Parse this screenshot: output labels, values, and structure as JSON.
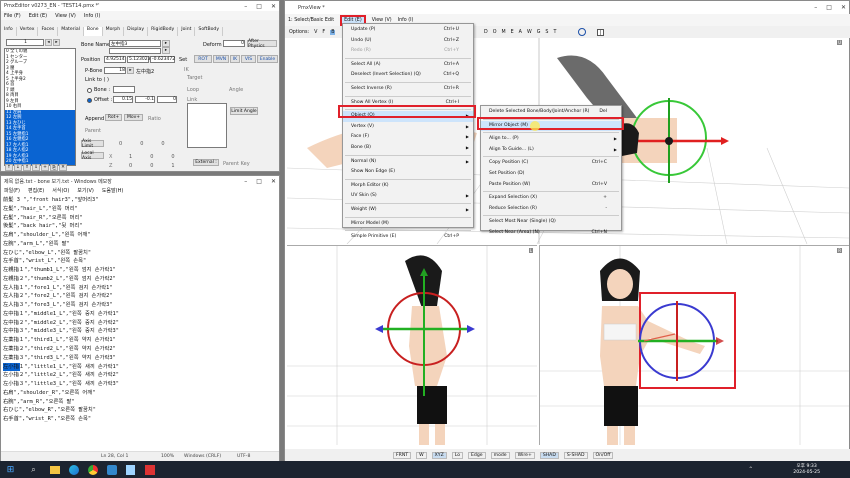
{
  "pmx": {
    "title": "PmxEditor v0273_EN - 'TEST14.pmx *'",
    "menu": [
      "File (F)",
      "Edit (E)",
      "View (V)",
      "Info (I)"
    ],
    "tabs": [
      "Info",
      "Vertex",
      "Faces",
      "Material",
      "Bone",
      "Morph",
      "Display",
      "RigidBody",
      "Joint",
      "SoftBody"
    ],
    "index": "1",
    "bones": [
      "0 全ての親",
      "1 センター",
      "2 グルーブ",
      "3 腰",
      "4 上半身",
      "5 上半身2",
      "6 首",
      "7 頭",
      "8 両目",
      "9 左目",
      "10 右目",
      "11 左肩",
      "12 左腕",
      "13 左ひじ",
      "14 左手首",
      "15 左親指1",
      "16 左親指2",
      "17 左人指1",
      "18 左人指2",
      "19 左人指3",
      "20 左中指1",
      "21 左中指2",
      "22 左中指3",
      "23 左薬指1",
      "24 左薬指2",
      "25 左薬指3",
      "26 左小指1",
      "27 左小指2",
      "28 左小指3",
      "29 右肩"
    ],
    "bone_name_label": "Bone Name",
    "bone_name": "左中指3",
    "bone_name_en": "",
    "defaults_label": "Deform",
    "deform_value": "0",
    "after_physics": "After Physics",
    "position_label": "Position",
    "pos": [
      "4.92514",
      "5.123023",
      "-0.623472"
    ],
    "set": "Set",
    "rot": "ROT",
    "mvn": "MVN",
    "ik": "IK",
    "vis": "VIS",
    "enable": "Enable",
    "pbone_label": "P-Bone",
    "pbone_value": "18",
    "pbone_name": "左中指2",
    "link_to": "Link to ( )",
    "bone_radio": "Bone :",
    "offset_radio": "Offset :",
    "offset": [
      "0.15",
      "-0.1",
      "0"
    ],
    "ik_label": "IK",
    "target_label": "Target",
    "loop_label": "Loop",
    "angle_label": "Angle",
    "link_label": "Link",
    "append_label": "Append",
    "rot_plus": "Rot+",
    "mov_plus": "Mov+",
    "ratio_label": "Ratio",
    "parent_label": "Parent",
    "fix_axis": "Axis Limit",
    "local_axis": "Local Axis",
    "x": "X",
    "z": "Z",
    "external": "External :",
    "parent_key": "Parent Key",
    "limit_angle": "Limit Angle",
    "axis_vals": [
      "0",
      "0",
      "0"
    ],
    "local_x": [
      "1",
      "0",
      "0"
    ],
    "local_z": [
      "0",
      "0",
      "1"
    ]
  },
  "notepad": {
    "title": "제목 없음.txt - bone 보기.txt - Windows 메모장",
    "menu": [
      "파일(F)",
      "편집(E)",
      "서식(O)",
      "보기(V)",
      "도움말(H)"
    ],
    "lines": [
      "前髪 3 \",\"front hair3\",\"앞머리3\"",
      "左髪\",\"hair_L\",\"왼쪽 머리\"",
      "右髪\",\"hair_R\",\"오른쪽 머리\"",
      "後髪\",\"back hair\",\"뒷 머리\"",
      "左肩\",\"shoulder_L\",\"왼쪽 어깨\"",
      "左腕\",\"arm_L\",\"왼쪽 팔\"",
      "左ひじ\",\"elbow_L\",\"왼쪽 팔꿈치\"",
      "左手首\",\"wrist_L\",\"왼쪽 손목\"",
      "左親指１\",\"thumb1_L\",\"왼쪽 엄지 손가락1\"",
      "左親指２\",\"thumb2_L\",\"왼쪽 엄지 손가락2\"",
      "左人指１\",\"fore1_L\",\"왼쪽 검지 손가락1\"",
      "左人指２\",\"fore2_L\",\"왼쪽 검지 손가락2\"",
      "左人指３\",\"fore3_L\",\"왼쪽 검지 손가락3\"",
      "左中指１\",\"middle1_L\",\"왼쪽 중지 손가락1\"",
      "左中指２\",\"middle2_L\",\"왼쪽 중지 손가락2\"",
      "左中指３\",\"middle3_L\",\"왼쪽 중지 손가락3\"",
      "左薬指１\",\"third1_L\",\"왼쪽 약지 손가락1\"",
      "左薬指２\",\"third2_L\",\"왼쪽 약지 손가락2\"",
      "左薬指３\",\"third3_L\",\"왼쪽 약지 손가락3\"",
      "左小指１\",\"little1_L\",\"왼쪽 새끼 손가락1\"",
      "左小指２\",\"little2_L\",\"왼쪽 새끼 손가락2\"",
      "左小指３\",\"little3_L\",\"왼쪽 새끼 손가락3\"",
      "右肩\",\"shoulder_R\",\"오른쪽 어깨\"",
      "右腕\",\"arm_R\",\"오른쪽 팔\"",
      "右ひじ\",\"elbow_R\",\"오른쪽 팔꿈치\"",
      "右手首\",\"wrist_R\",\"오른쪽 손목\""
    ],
    "highlight": "左小指",
    "status": [
      "Ln 28, Col 1",
      "100%",
      "Windows (CRLF)",
      "UTF-8"
    ]
  },
  "view": {
    "title": "PmxView *",
    "menu": [
      "1: Select/Basic Edit",
      "Edit (E)",
      "View (V)",
      "Info (I)"
    ],
    "options": "Options:",
    "opt_letters": [
      "V",
      "F",
      "B"
    ],
    "tools": [
      "D",
      "O",
      "M",
      "E",
      "A",
      "W",
      "G",
      "S",
      "T"
    ],
    "view_labels": [
      "U",
      "L",
      "R"
    ],
    "bottom": [
      "FRNT",
      "W",
      "XYZ",
      "Lo",
      "Edge",
      "mode",
      "Wire+",
      "SHAD",
      "S-SHAD",
      "On/Off"
    ]
  },
  "edit_menu": [
    {
      "l": "Update (P)",
      "s": "Ctrl+U"
    },
    {
      "l": "Undo (U)",
      "s": "Ctrl+Z"
    },
    {
      "l": "Redo (R)",
      "s": "Ctrl+Y"
    },
    {
      "sep": 1
    },
    {
      "l": "Select All (A)",
      "s": "Ctrl+A"
    },
    {
      "l": "Deselect (Invert Selection) (Q)",
      "s": "Ctrl+Q"
    },
    {
      "sep": 1
    },
    {
      "l": "Select Inverse (R)",
      "s": "Ctrl+R"
    },
    {
      "sep": 1
    },
    {
      "l": "Show All Vertex (I)",
      "s": "Ctrl+I"
    },
    {
      "sep": 1
    },
    {
      "l": "Object (O)",
      "a": 1,
      "hl": 1
    },
    {
      "l": "Vertex (V)",
      "a": 1
    },
    {
      "l": "Face (F)",
      "a": 1
    },
    {
      "l": "Bone (B)",
      "a": 1
    },
    {
      "sep": 1
    },
    {
      "l": "Normal (N)",
      "a": 1
    },
    {
      "l": "Show Non Edge (E)"
    },
    {
      "sep": 1
    },
    {
      "l": "Morph Editor (K)"
    },
    {
      "l": "UV Skin (S)",
      "a": 1
    },
    {
      "sep": 1
    },
    {
      "l": "Weight (W)",
      "a": 1
    },
    {
      "sep": 1
    },
    {
      "l": "Mirror Model (M)"
    },
    {
      "sep": 1
    },
    {
      "l": "Simple Primitive (E)",
      "s": "Ctrl+P"
    }
  ],
  "object_menu": [
    {
      "l": "Delete Selected Bone/Body/Joint/Anchor (R)",
      "s": "Del"
    },
    {
      "sep": 1
    },
    {
      "l": "Mirror Object (M)",
      "hl": 1
    },
    {
      "sep": 1
    },
    {
      "l": "Align to... (P)",
      "a": 1
    },
    {
      "l": "Align To Guide... (L)",
      "a": 1
    },
    {
      "sep": 1
    },
    {
      "l": "Copy Position (C)",
      "s": "Ctrl+C"
    },
    {
      "l": "Set Position (D)"
    },
    {
      "l": "Paste Position (W)",
      "s": "Ctrl+V"
    },
    {
      "sep": 1
    },
    {
      "l": "Expand Selection (X)",
      "s": "+"
    },
    {
      "l": "Reduce Selection (R)",
      "s": "-"
    },
    {
      "sep": 1
    },
    {
      "l": "Select Most Near (Single) (Q)"
    },
    {
      "l": "Select Near (Area) (N)",
      "s": "Ctrl+N"
    }
  ],
  "taskbar": {
    "time": "오후 9:33",
    "date": "2024-05-25"
  },
  "colors": {
    "accent": "#0a64d2",
    "highlight_box": "#e0202a",
    "taskbar": "#1c2430"
  }
}
